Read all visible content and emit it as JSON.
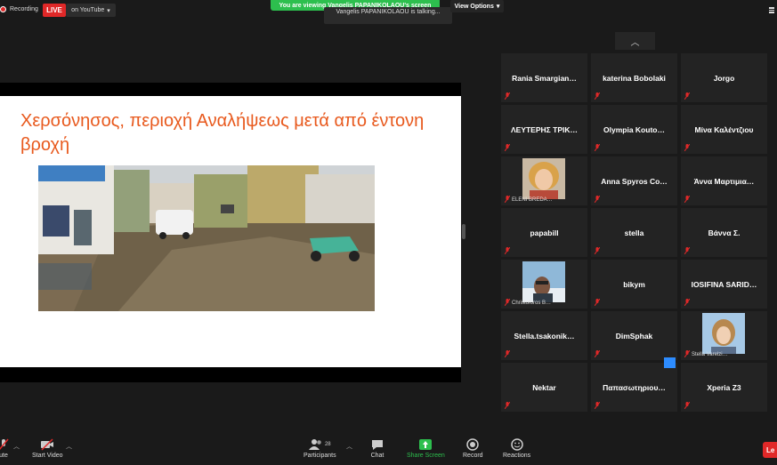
{
  "top_bar": {
    "recording_label": "Recording",
    "live_label": "LIVE",
    "stream_label": "on YouTube",
    "viewing_banner": "You are viewing Vangelis PAPANIKOLAOU's screen",
    "talking_label": "Vangelis PAPANIKOLAOU is talking...",
    "view_options_label": "View Options"
  },
  "slide": {
    "title": "Χερσόνησος, περιοχή Αναλήψεως μετά από έντονη βροχή"
  },
  "participants": [
    {
      "name": "Rania  Smargian…",
      "video": false
    },
    {
      "name": "katerina Bobolaki",
      "video": false
    },
    {
      "name": "Jorgo",
      "video": false
    },
    {
      "name": "ΛΕΥΤΕΡΗΣ  ΤΡΙΚ…",
      "video": false
    },
    {
      "name": "Olympia  Kouto…",
      "video": false
    },
    {
      "name": "Μίνα Καλέντζιου",
      "video": false
    },
    {
      "name": "ELENI BREDA…",
      "video": true
    },
    {
      "name": "Anna Spyros Co…",
      "video": false
    },
    {
      "name": "Άννα Μαρτιμια…",
      "video": false
    },
    {
      "name": "papabill",
      "video": false
    },
    {
      "name": "stella",
      "video": false
    },
    {
      "name": "Βάννα Σ.",
      "video": false
    },
    {
      "name": "Christoforos B…",
      "video": true
    },
    {
      "name": "bikym",
      "video": false
    },
    {
      "name": "IOSIFINA  SARID…",
      "video": false
    },
    {
      "name": "Stella.tsakonik…",
      "video": false
    },
    {
      "name": "DimSphak",
      "video": false
    },
    {
      "name": "Stella Varelzi…",
      "video": true
    },
    {
      "name": "Nektar",
      "video": false
    },
    {
      "name": "Παπασωτηριου…",
      "video": false
    },
    {
      "name": "Xperia Z3",
      "video": false
    }
  ],
  "toolbar": {
    "mute_label": "ute",
    "start_video_label": "Start Video",
    "participants_label": "Participants",
    "participants_count": "28",
    "chat_label": "Chat",
    "share_screen_label": "Share Screen",
    "record_label": "Record",
    "reactions_label": "Reactions",
    "leave_label": "Le"
  },
  "colors": {
    "live_red": "#e02828",
    "banner_green": "#2dbf4e",
    "slide_title_orange": "#e8591d",
    "share_screen_green": "#2dbf4e",
    "accent_blue": "#2d8cff"
  },
  "icons": {
    "mic_muted": "mic-muted-icon",
    "video_off": "video-off-icon",
    "participants": "participants-icon",
    "chat": "chat-icon",
    "share": "share-screen-icon",
    "record": "record-icon",
    "reactions": "reactions-icon"
  }
}
